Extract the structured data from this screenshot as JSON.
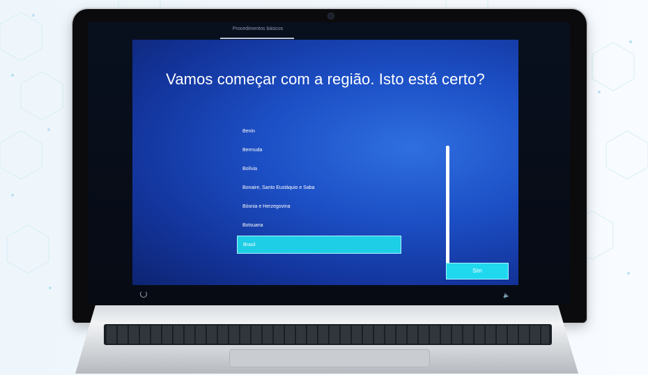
{
  "setup_screen": {
    "stage_label": "Procedimentos básicos",
    "title": "Vamos começar com a região. Isto está certo?",
    "regions": [
      "Benin",
      "Bermuda",
      "Bolívia",
      "Bonaire, Santo Eustáquio e Saba",
      "Bósnia e Herzegovina",
      "Botsuana",
      "Brasil"
    ],
    "selected_region": "Brasil",
    "confirm_button_label": "Sim"
  },
  "icons": {
    "power": "power-icon",
    "volume": "volume-icon"
  },
  "colors": {
    "accent": "#1fd8ee",
    "background_blue": "#1c4fc5"
  }
}
